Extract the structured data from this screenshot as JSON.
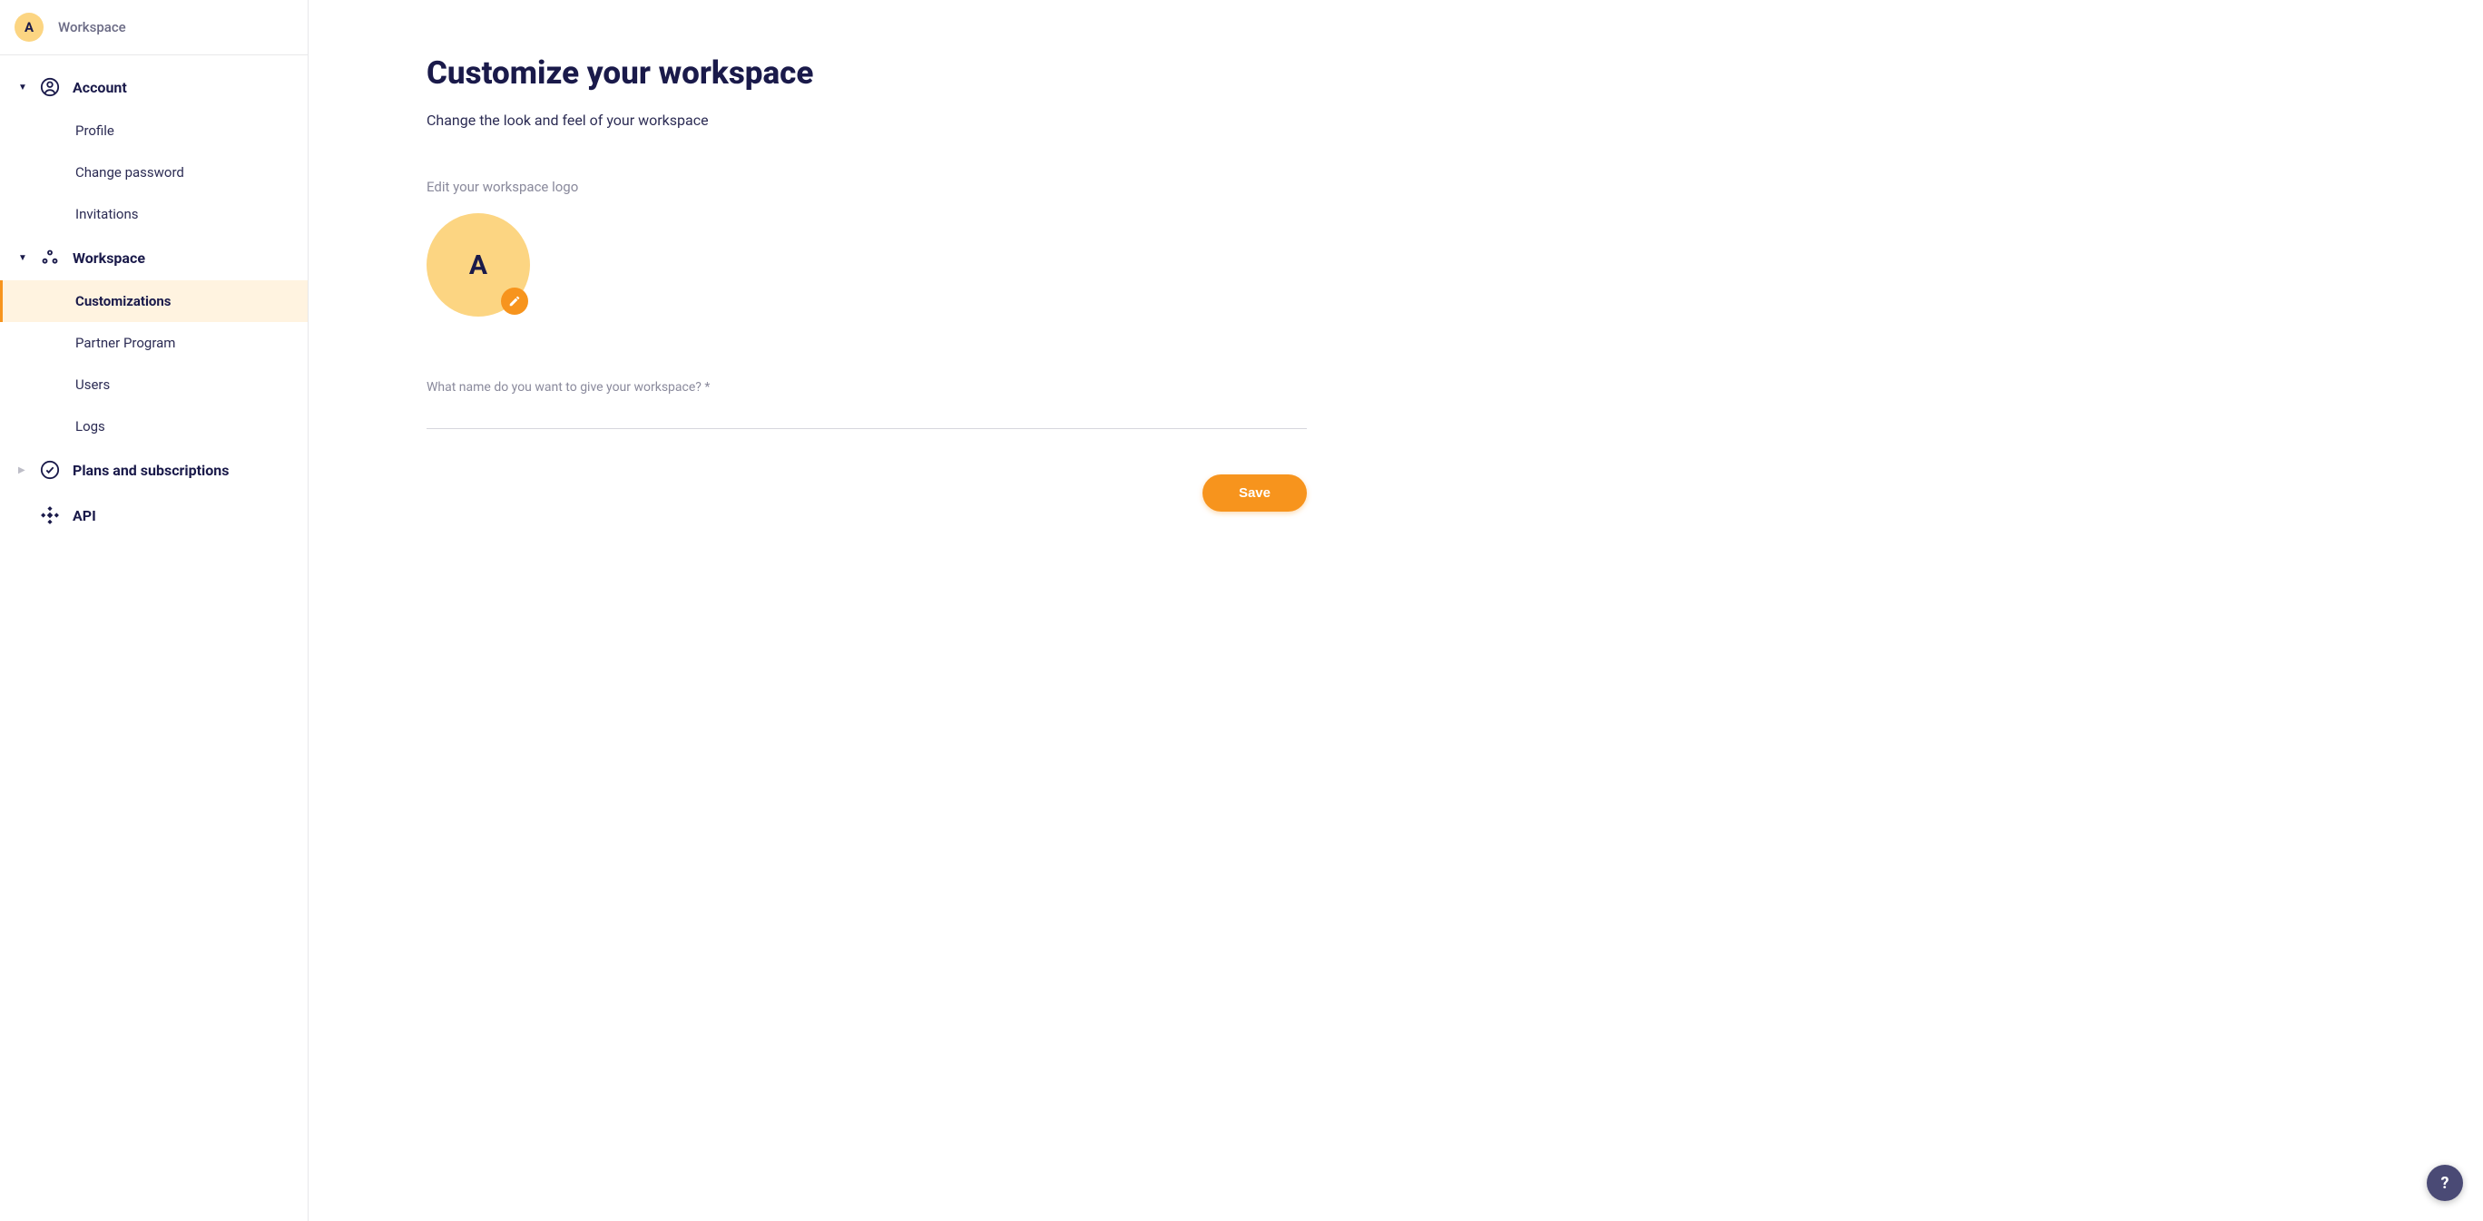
{
  "header": {
    "avatar_letter": "A",
    "workspace_label": "Workspace"
  },
  "sidebar": {
    "groups": [
      {
        "label": "Account",
        "expanded": true,
        "items": [
          {
            "label": "Profile"
          },
          {
            "label": "Change password"
          },
          {
            "label": "Invitations"
          }
        ]
      },
      {
        "label": "Workspace",
        "expanded": true,
        "items": [
          {
            "label": "Customizations",
            "active": true
          },
          {
            "label": "Partner Program"
          },
          {
            "label": "Users"
          },
          {
            "label": "Logs"
          }
        ]
      },
      {
        "label": "Plans and subscriptions",
        "expanded": false,
        "items": []
      },
      {
        "label": "API",
        "expanded": null,
        "items": []
      }
    ]
  },
  "main": {
    "title": "Customize your workspace",
    "subtitle": "Change the look and feel of your workspace",
    "logo_section_label": "Edit your workspace logo",
    "logo_letter": "A",
    "name_field_label": "What name do you want to give your workspace?",
    "name_field_required_mark": "*",
    "name_field_value": "",
    "save_label": "Save"
  },
  "help": {
    "label": "?"
  }
}
